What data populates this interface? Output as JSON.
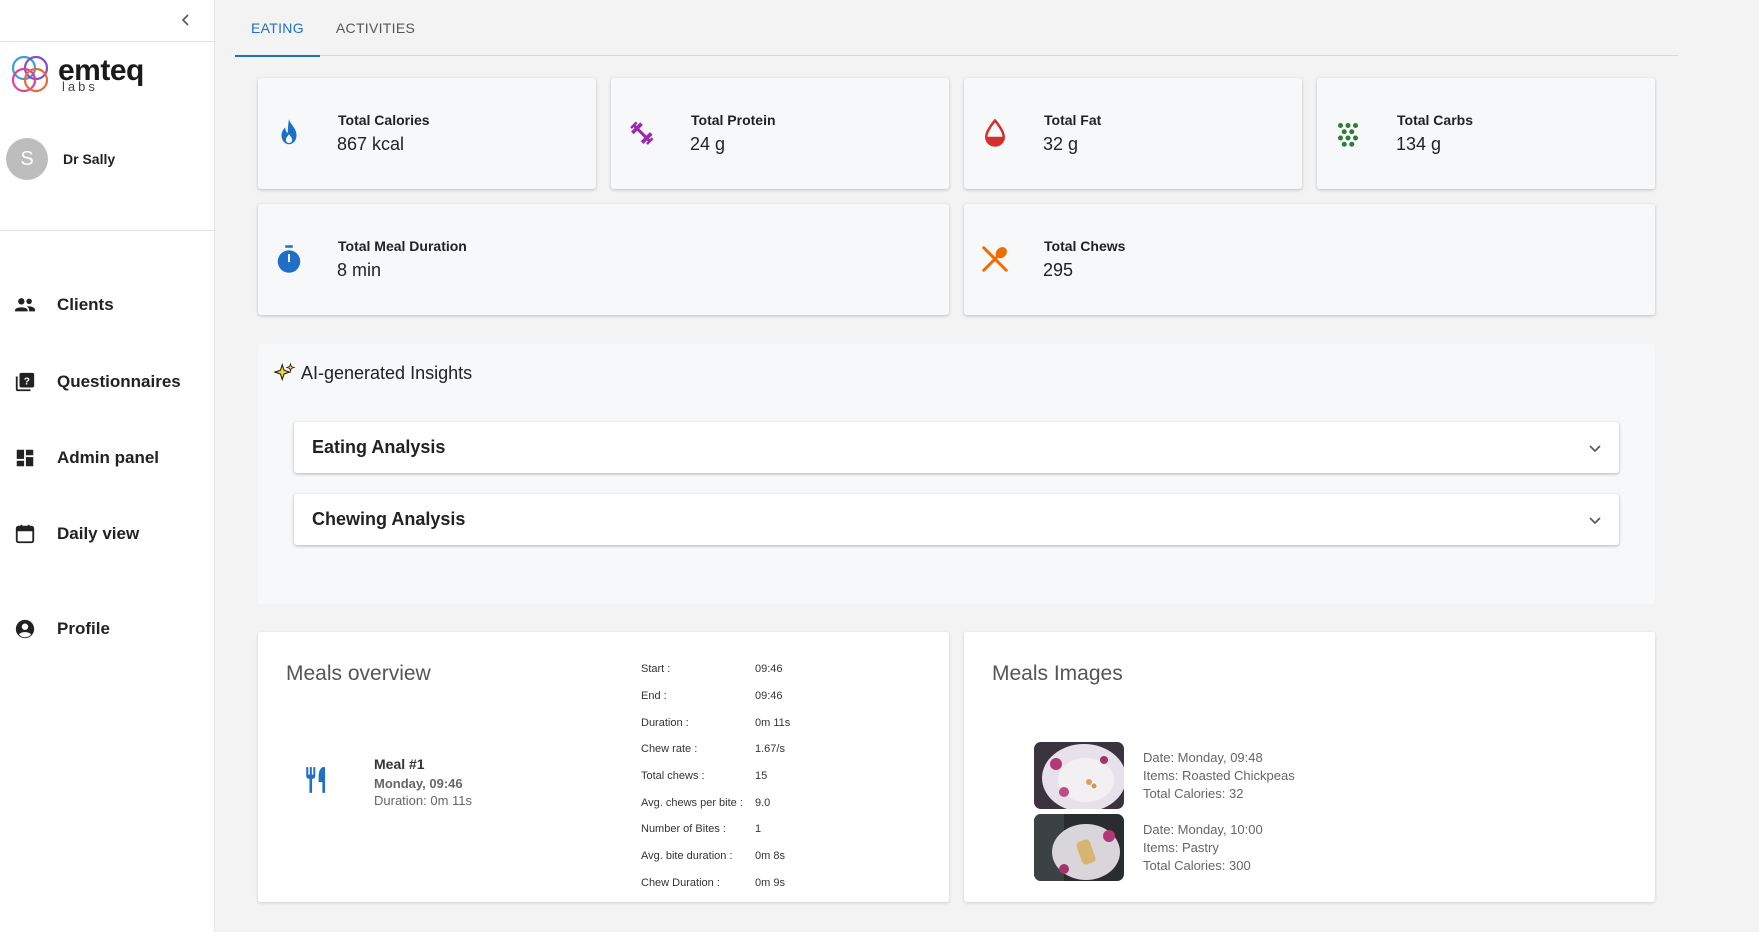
{
  "sidebar": {
    "logo": {
      "brand": "emteq",
      "sub": "labs"
    },
    "user": {
      "initial": "S",
      "name": "Dr Sally"
    },
    "nav": [
      {
        "label": "Clients",
        "icon": "people-icon"
      },
      {
        "label": "Questionnaires",
        "icon": "quiz-icon"
      },
      {
        "label": "Admin panel",
        "icon": "dashboard-icon"
      },
      {
        "label": "Daily view",
        "icon": "calendar-icon"
      },
      {
        "label": "Profile",
        "icon": "account-circle-icon"
      }
    ]
  },
  "tabs": [
    {
      "label": "EATING",
      "active": true
    },
    {
      "label": "ACTIVITIES",
      "active": false
    }
  ],
  "stats": {
    "calories": {
      "title": "Total Calories",
      "value": "867 kcal",
      "color": "#1f6fc7"
    },
    "protein": {
      "title": "Total Protein",
      "value": "24 g",
      "color": "#9c27b0"
    },
    "fat": {
      "title": "Total Fat",
      "value": "32 g",
      "color": "#d32f2f"
    },
    "carbs": {
      "title": "Total Carbs",
      "value": "134 g",
      "color": "#2e7d32"
    },
    "duration": {
      "title": "Total Meal Duration",
      "value": "8 min",
      "color": "#1f6fc7"
    },
    "chews": {
      "title": "Total Chews",
      "value": "295",
      "color": "#ef6c00"
    }
  },
  "insights": {
    "title": "AI-generated Insights",
    "sections": [
      "Eating Analysis",
      "Chewing Analysis"
    ]
  },
  "meals_overview": {
    "title": "Meals overview",
    "meal": {
      "name": "Meal #1",
      "time": "Monday, 09:46",
      "duration": "Duration: 0m 11s"
    },
    "details": [
      {
        "k": "Start :",
        "v": "09:46"
      },
      {
        "k": "End :",
        "v": "09:46"
      },
      {
        "k": "Duration :",
        "v": "0m 11s"
      },
      {
        "k": "Chew rate :",
        "v": "1.67/s"
      },
      {
        "k": "Total chews :",
        "v": "15"
      },
      {
        "k": "Avg. chews per bite :",
        "v": "9.0"
      },
      {
        "k": "Number of Bites :",
        "v": "1"
      },
      {
        "k": "Avg. bite duration :",
        "v": "0m 8s"
      },
      {
        "k": "Chew Duration :",
        "v": "0m 9s"
      }
    ]
  },
  "meals_images": {
    "title": "Meals Images",
    "items": [
      {
        "date": "Date: Monday, 09:48",
        "items": "Items: Roasted Chickpeas",
        "calories": "Total Calories: 32"
      },
      {
        "date": "Date: Monday, 10:00",
        "items": "Items: Pastry",
        "calories": "Total Calories: 300"
      }
    ]
  }
}
